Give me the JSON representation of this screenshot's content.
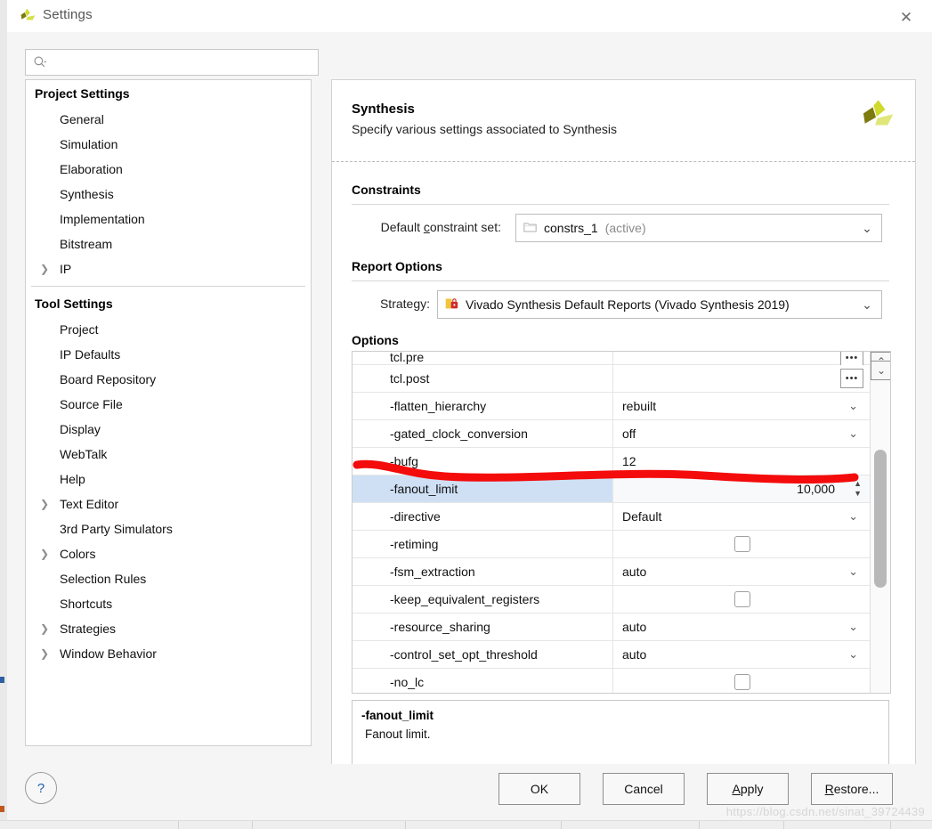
{
  "window": {
    "title": "Settings",
    "app_icon": "vivado-logo-icon",
    "close_label": "✕"
  },
  "sidebar": {
    "search": {
      "value": "",
      "placeholder": "",
      "icon": "search-icon"
    },
    "groups": [
      {
        "label": "Project Settings",
        "items": [
          {
            "label": "General",
            "expandable": false,
            "selected": false
          },
          {
            "label": "Simulation",
            "expandable": false,
            "selected": false
          },
          {
            "label": "Elaboration",
            "expandable": false,
            "selected": false
          },
          {
            "label": "Synthesis",
            "expandable": false,
            "selected": true
          },
          {
            "label": "Implementation",
            "expandable": false,
            "selected": false
          },
          {
            "label": "Bitstream",
            "expandable": false,
            "selected": false
          },
          {
            "label": "IP",
            "expandable": true,
            "selected": false
          }
        ]
      },
      {
        "label": "Tool Settings",
        "items": [
          {
            "label": "Project",
            "expandable": false,
            "selected": false
          },
          {
            "label": "IP Defaults",
            "expandable": false,
            "selected": false
          },
          {
            "label": "Board Repository",
            "expandable": false,
            "selected": false
          },
          {
            "label": "Source File",
            "expandable": false,
            "selected": false
          },
          {
            "label": "Display",
            "expandable": false,
            "selected": false
          },
          {
            "label": "WebTalk",
            "expandable": false,
            "selected": false
          },
          {
            "label": "Help",
            "expandable": false,
            "selected": false
          },
          {
            "label": "Text Editor",
            "expandable": true,
            "selected": false
          },
          {
            "label": "3rd Party Simulators",
            "expandable": false,
            "selected": false
          },
          {
            "label": "Colors",
            "expandable": true,
            "selected": false
          },
          {
            "label": "Selection Rules",
            "expandable": false,
            "selected": false
          },
          {
            "label": "Shortcuts",
            "expandable": false,
            "selected": false
          },
          {
            "label": "Strategies",
            "expandable": true,
            "selected": false
          },
          {
            "label": "Window Behavior",
            "expandable": true,
            "selected": false
          }
        ]
      }
    ]
  },
  "panel": {
    "title": "Synthesis",
    "subtitle": "Specify various settings associated to Synthesis",
    "logo": "vivado-logo-icon",
    "constraints": {
      "section_label": "Constraints",
      "field_label_pre": "Default ",
      "field_label_key": "c",
      "field_label_post": "onstraint set:",
      "value": "constrs_1",
      "value_suffix": "(active)",
      "icon": "folder-icon"
    },
    "report_options": {
      "section_label": "Report Options",
      "field_label": "Strategy:",
      "value": "Vivado Synthesis Default Reports (Vivado Synthesis 2019)",
      "icon": "strategy-lock-icon"
    },
    "options": {
      "section_label": "Options",
      "rows": [
        {
          "name": "tcl.pre",
          "value": "",
          "control": "browse",
          "selected": false,
          "clipped": true
        },
        {
          "name": "tcl.post",
          "value": "",
          "control": "browse",
          "selected": false
        },
        {
          "name": "-flatten_hierarchy",
          "value": "rebuilt",
          "control": "dropdown",
          "selected": false
        },
        {
          "name": "-gated_clock_conversion",
          "value": "off",
          "control": "dropdown",
          "selected": false
        },
        {
          "name": "-bufg",
          "value": "12",
          "control": "text",
          "selected": false
        },
        {
          "name": "-fanout_limit",
          "value": "10,000",
          "control": "spinner",
          "selected": true
        },
        {
          "name": "-directive",
          "value": "Default",
          "control": "dropdown",
          "selected": false
        },
        {
          "name": "-retiming",
          "value": "",
          "control": "checkbox",
          "checked": false,
          "selected": false
        },
        {
          "name": "-fsm_extraction",
          "value": "auto",
          "control": "dropdown",
          "selected": false
        },
        {
          "name": "-keep_equivalent_registers",
          "value": "",
          "control": "checkbox",
          "checked": false,
          "selected": false
        },
        {
          "name": "-resource_sharing",
          "value": "auto",
          "control": "dropdown",
          "selected": false
        },
        {
          "name": "-control_set_opt_threshold",
          "value": "auto",
          "control": "dropdown",
          "selected": false
        },
        {
          "name": "-no_lc",
          "value": "",
          "control": "checkbox",
          "checked": false,
          "selected": false
        }
      ],
      "browse_label": "•••",
      "scroll": {
        "up_icon": "chevron-up-icon",
        "down_icon": "chevron-down-icon"
      }
    },
    "description": {
      "title": "-fanout_limit",
      "text": "Fanout limit."
    }
  },
  "footer": {
    "help_label": "?",
    "buttons": [
      {
        "label": "OK",
        "mnemonic": ""
      },
      {
        "label": "Cancel",
        "mnemonic": ""
      },
      {
        "label": "Apply",
        "mnemonic": "A"
      },
      {
        "label": "Restore...",
        "mnemonic": "R"
      }
    ],
    "watermark": "https://blog.csdn.net/sinat_39724439"
  },
  "colors": {
    "selection": "#cfe0f5",
    "annotation": "#f40b0b",
    "brand_green": "#c9d900",
    "brand_olive": "#7d7a10"
  }
}
